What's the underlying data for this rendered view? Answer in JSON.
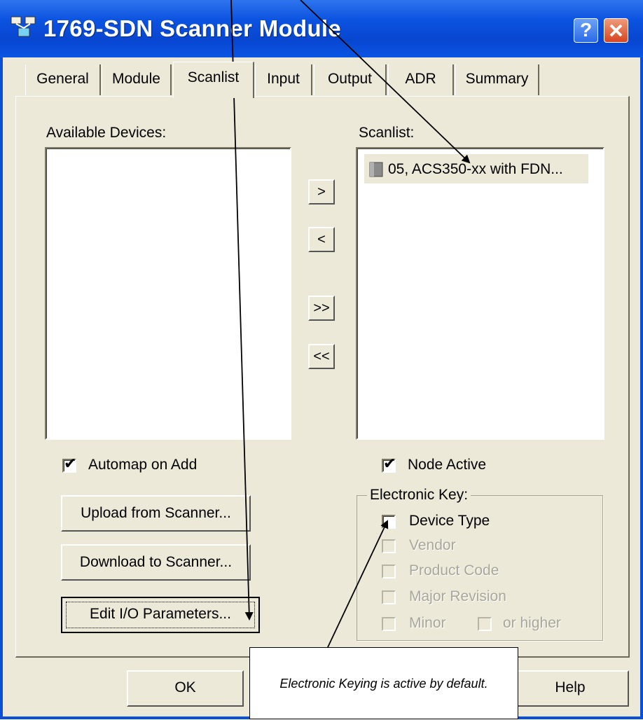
{
  "window": {
    "title": "1769-SDN Scanner Module"
  },
  "title_buttons": {
    "help": "?"
  },
  "tabs": [
    {
      "label": "General"
    },
    {
      "label": "Module"
    },
    {
      "label": "Scanlist",
      "selected": true
    },
    {
      "label": "Input"
    },
    {
      "label": "Output"
    },
    {
      "label": "ADR"
    },
    {
      "label": "Summary"
    }
  ],
  "available_devices": {
    "label": "Available Devices:",
    "items": []
  },
  "transfer_buttons": {
    "add": ">",
    "remove": "<",
    "add_all": ">>",
    "remove_all": "<<"
  },
  "scanlist": {
    "label": "Scanlist:",
    "items": [
      {
        "label": "05, ACS350-xx with FDN...",
        "icon": "device-icon"
      }
    ]
  },
  "automap": {
    "label": "Automap on Add",
    "checked": true
  },
  "buttons": {
    "upload": "Upload from Scanner...",
    "download": "Download to Scanner...",
    "edit_io": "Edit I/O Parameters..."
  },
  "node_active": {
    "label": "Node Active",
    "checked": true
  },
  "electronic_key": {
    "legend": "Electronic Key:",
    "device_type": {
      "label": "Device Type",
      "checked": false,
      "enabled": true
    },
    "vendor": {
      "label": "Vendor",
      "enabled": false
    },
    "product_code": {
      "label": "Product Code",
      "enabled": false
    },
    "major_revision": {
      "label": "Major Revision",
      "enabled": false
    },
    "minor": {
      "label": "Minor",
      "enabled": false
    },
    "or_higher": {
      "label": "or higher",
      "enabled": false
    }
  },
  "dialog_buttons": {
    "ok": "OK",
    "help": "Help"
  },
  "annotation": {
    "callout": "Electronic Keying is active by default."
  },
  "colors": {
    "title_bar": "#0a4fd6",
    "dialog_bg": "#ece9d8",
    "close_button": "#d6451f",
    "selected_row": "#ece9d8"
  }
}
